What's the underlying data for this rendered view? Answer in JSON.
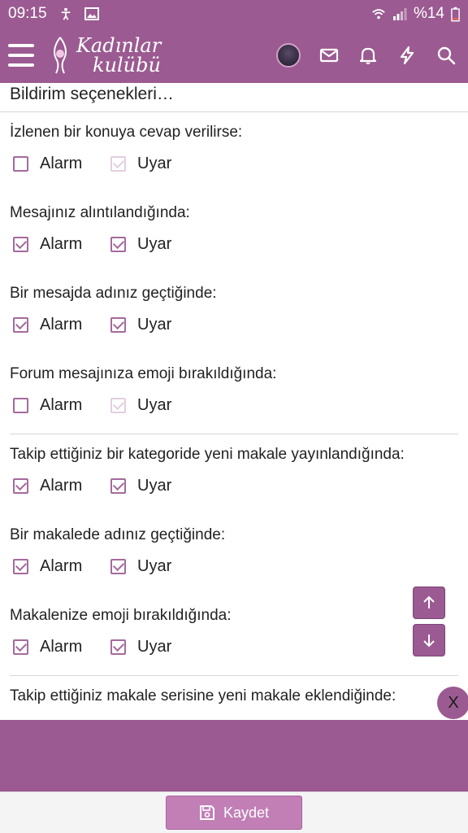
{
  "statusbar": {
    "time": "09:15",
    "battery": "%14"
  },
  "header": {
    "logo_line1": "Kadınlar",
    "logo_line2": "kulübü"
  },
  "section_title": "Bildirim seçenekleri…",
  "options": {
    "alarm_label": "Alarm",
    "warn_label": "Uyar"
  },
  "items": [
    {
      "question": "İzlenen bir konuya cevap verilirse:",
      "alarm_checked": false,
      "warn_checked": true,
      "warn_disabled": true
    },
    {
      "question": "Mesajınız alıntılandığında:",
      "alarm_checked": true,
      "warn_checked": true,
      "warn_disabled": false
    },
    {
      "question": "Bir mesajda adınız geçtiğinde:",
      "alarm_checked": true,
      "warn_checked": true,
      "warn_disabled": false
    },
    {
      "question": "Forum mesajınıza emoji bırakıldığında:",
      "alarm_checked": false,
      "warn_checked": true,
      "warn_disabled": true
    },
    {
      "question": "Takip ettiğiniz bir kategoride yeni makale yayınlandığında:",
      "alarm_checked": true,
      "warn_checked": true,
      "warn_disabled": false
    },
    {
      "question": "Bir makalede adınız geçtiğinde:",
      "alarm_checked": true,
      "warn_checked": true,
      "warn_disabled": false
    },
    {
      "question": "Makalenize emoji bırakıldığında:",
      "alarm_checked": true,
      "warn_checked": true,
      "warn_disabled": false
    },
    {
      "question": "Takip ettiğiniz makale serisine yeni makale eklendiğinde:"
    }
  ],
  "close_label": "X",
  "save_label": "Kaydet",
  "colors": {
    "brand": "#9b5a91",
    "checkbox": "#a56a9c",
    "save_button": "#c17fb6"
  }
}
